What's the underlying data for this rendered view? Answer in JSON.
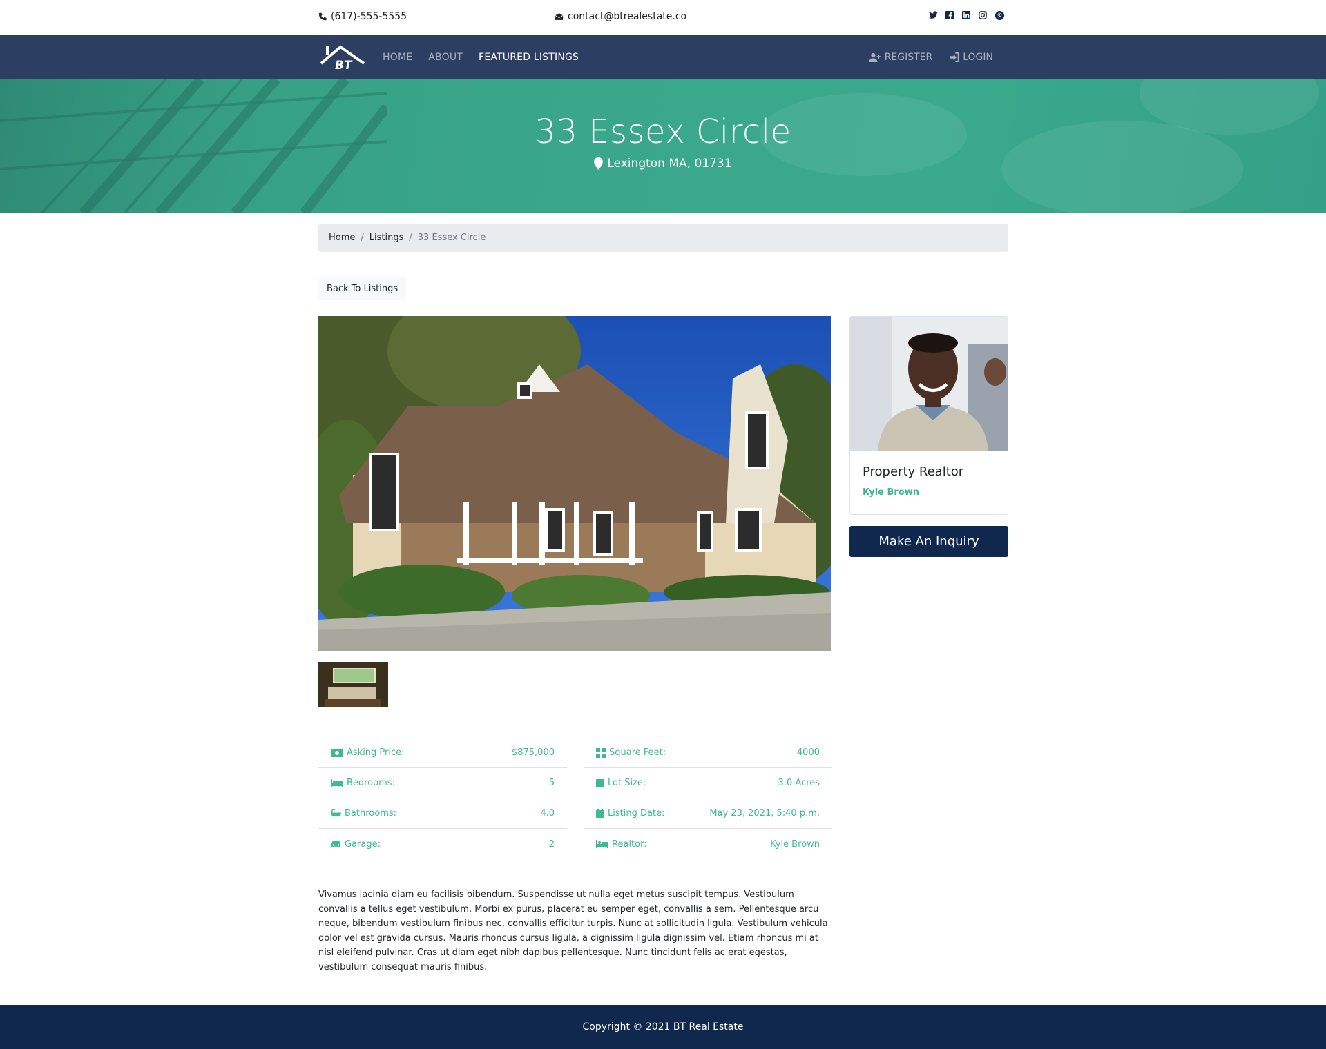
{
  "topbar": {
    "phone": "(617)-555-5555",
    "email": "contact@btrealestate.co",
    "social": [
      "twitter-icon",
      "facebook-icon",
      "linkedin-icon",
      "instagram-icon",
      "pinterest-icon"
    ]
  },
  "navbar": {
    "logo_text": "BT",
    "links": [
      {
        "label": "HOME",
        "active": false
      },
      {
        "label": "ABOUT",
        "active": false
      },
      {
        "label": "FEATURED LISTINGS",
        "active": true
      }
    ],
    "register": "REGISTER",
    "login": "LOGIN"
  },
  "hero": {
    "title": "33 Essex Circle",
    "location": "Lexington MA, 01731"
  },
  "breadcrumb": {
    "home": "Home",
    "listings": "Listings",
    "current": "33 Essex Circle"
  },
  "back_button": "Back To Listings",
  "realtor": {
    "title": "Property Realtor",
    "name": "Kyle Brown"
  },
  "inquiry_button": "Make An Inquiry",
  "details_left": [
    {
      "icon": "money-icon",
      "label": "Asking Price:",
      "value": "$875,000"
    },
    {
      "icon": "bed-icon",
      "label": "Bedrooms:",
      "value": "5"
    },
    {
      "icon": "bath-icon",
      "label": "Bathrooms:",
      "value": "4.0"
    },
    {
      "icon": "car-icon",
      "label": "Garage:",
      "value": "2"
    }
  ],
  "details_right": [
    {
      "icon": "grid-icon",
      "label": "Square Feet:",
      "value": "4000"
    },
    {
      "icon": "square-icon",
      "label": "Lot Size:",
      "value": "3.0 Acres"
    },
    {
      "icon": "calendar-icon",
      "label": "Listing Date:",
      "value": "May 23, 2021, 5:40 p.m."
    },
    {
      "icon": "bed-icon",
      "label": "Realtor:",
      "value": "Kyle Brown"
    }
  ],
  "description": "Vivamus lacinia diam eu facilisis bibendum. Suspendisse ut nulla eget metus suscipit tempus. Vestibulum convallis a tellus eget vestibulum. Morbi ex purus, placerat eu semper eget, convallis a sem. Pellentesque arcu neque, bibendum vestibulum finibus nec, convallis efficitur turpis. Nunc at sollicitudin ligula. Vestibulum vehicula dolor vel est gravida cursus. Mauris rhoncus cursus ligula, a dignissim ligula dignissim vel. Etiam rhoncus mi at nisl eleifend pulvinar. Cras ut diam eget nibh dapibus pellentesque. Nunc tincidunt felis ac erat egestas, vestibulum consequat mauris finibus.",
  "footer": "Copyright © 2021 BT Real Estate",
  "colors": {
    "navbar": "#2c3e62",
    "hero": "#3aa78a",
    "accent": "#3cba92",
    "dark_navy": "#10284e"
  }
}
